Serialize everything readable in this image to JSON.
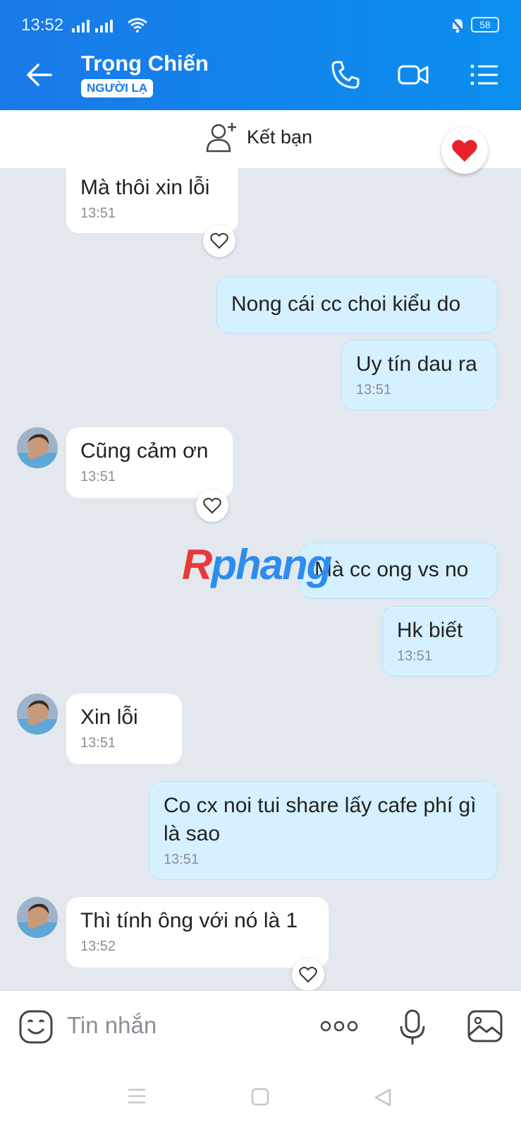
{
  "status_bar": {
    "time": "13:52",
    "battery": "58"
  },
  "header": {
    "contact_name": "Trọng Chiến",
    "badge": "NGƯỜI LẠ"
  },
  "friend_bar": {
    "add_friend_label": "Kết bạn"
  },
  "watermark": {
    "part1": "R",
    "part2": "phang"
  },
  "messages": [
    {
      "dir": "in",
      "text": "Mà thôi xin lỗi",
      "time": "13:51"
    },
    {
      "dir": "out",
      "text": "Nong cái cc choi kiểu do"
    },
    {
      "dir": "out",
      "text": "Uy tín dau ra",
      "time": "13:51"
    },
    {
      "dir": "in",
      "text": "Cũng cảm ơn",
      "time": "13:51"
    },
    {
      "dir": "out",
      "text": "Mà cc ong vs no"
    },
    {
      "dir": "out",
      "text": "Hk biết",
      "time": "13:51"
    },
    {
      "dir": "in",
      "text": "Xin lỗi",
      "time": "13:51"
    },
    {
      "dir": "out",
      "text": "Co cx noi tui share lấy cafe phí gì là sao",
      "time": "13:51"
    },
    {
      "dir": "in",
      "text": "Thì tính ông với nó là 1",
      "time": "13:52"
    }
  ],
  "input": {
    "placeholder": "Tin nhắn"
  },
  "colors": {
    "primary": "#1a79e8",
    "outgoing_bubble": "#d5f1ff",
    "background": "#e3e8ef"
  }
}
